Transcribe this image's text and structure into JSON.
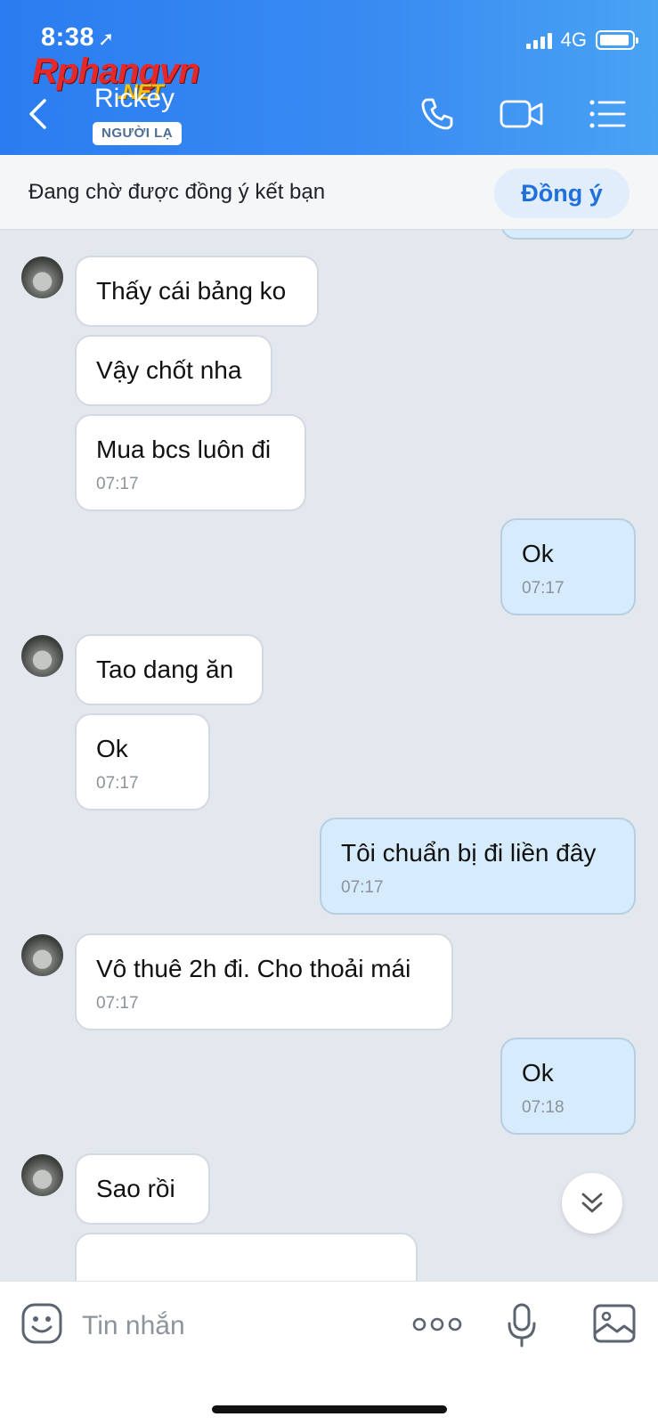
{
  "status_bar": {
    "time": "8:38",
    "location_icon": "location-arrow-icon",
    "network": "4G"
  },
  "watermark": {
    "part1": "Rphang",
    "part2": "vn",
    "part3": ".NET"
  },
  "header": {
    "contact_name": "Rickey",
    "badge": "NGƯỜI LẠ",
    "icons": [
      "back-icon",
      "phone-icon",
      "video-icon",
      "menu-icon"
    ]
  },
  "friend_request": {
    "text": "Đang chờ được đồng ý kết bạn",
    "accept_label": "Đồng ý"
  },
  "messages": [
    {
      "sender": "other",
      "text": "Thấy cái bảng ko",
      "time": ""
    },
    {
      "sender": "other",
      "text": "Vậy chốt nha",
      "time": ""
    },
    {
      "sender": "other",
      "text": "Mua bcs luôn đi",
      "time": "07:17"
    },
    {
      "sender": "me",
      "text": "Ok",
      "time": "07:17"
    },
    {
      "sender": "other",
      "text": "Tao dang ăn",
      "time": ""
    },
    {
      "sender": "other",
      "text": "Ok",
      "time": "07:17"
    },
    {
      "sender": "me",
      "text": "Tôi chuẩn bị đi liền đây",
      "time": "07:17"
    },
    {
      "sender": "other",
      "text": "Vô thuê 2h đi. Cho thoải mái",
      "time": "07:17"
    },
    {
      "sender": "me",
      "text": "Ok",
      "time": "07:18"
    },
    {
      "sender": "other",
      "text": "Sao rồi",
      "time": ""
    }
  ],
  "input_bar": {
    "placeholder": "Tin nhắn",
    "icons": [
      "sticker-icon",
      "more-icon",
      "microphone-icon",
      "image-icon"
    ]
  },
  "colors": {
    "header_start": "#2b7cf0",
    "header_end": "#49a3f3",
    "my_bubble": "#d6ebfb",
    "accent": "#1f6fdd"
  }
}
